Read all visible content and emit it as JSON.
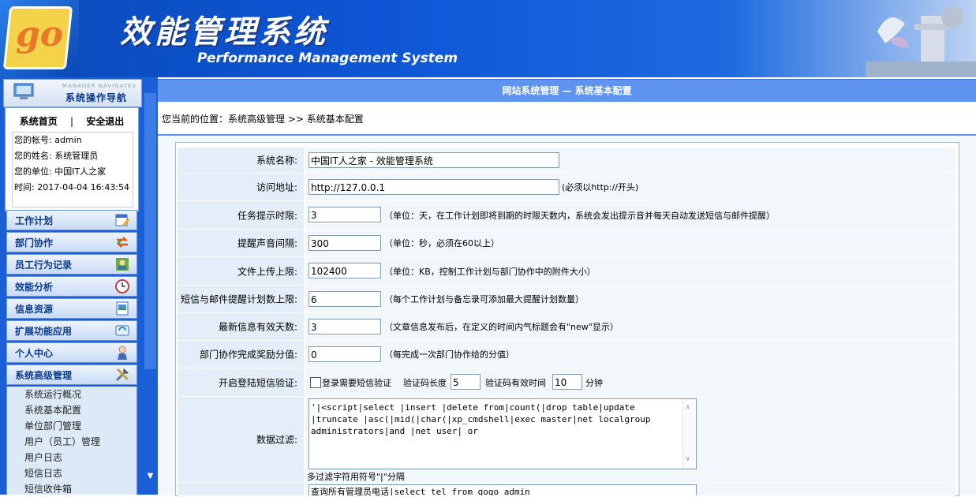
{
  "header": {
    "logo_text": "go",
    "title": "效能管理系统",
    "subtitle": "Performance Management System"
  },
  "sidebar": {
    "nav_small": "MANAGER NAVIGATES",
    "nav_title": "系统操作导航",
    "home_link": "系统首页",
    "link_sep": "|",
    "logout_link": "安全退出",
    "user_info": [
      "您的帐号:  admin",
      "您的姓名:  系统管理员",
      "您的单位:  中国IT人之家",
      "时间:  2017-04-04 16:43:54"
    ],
    "menus": [
      {
        "label": "工作计划",
        "icon": "calendar-edit-icon"
      },
      {
        "label": "部门协作",
        "icon": "exchange-arrows-icon"
      },
      {
        "label": "员工行为记录",
        "icon": "user-record-icon"
      },
      {
        "label": "效能分析",
        "icon": "clock-icon"
      },
      {
        "label": "信息资源",
        "icon": "document-image-icon"
      },
      {
        "label": "扩展功能应用",
        "icon": "extension-icon"
      },
      {
        "label": "个人中心",
        "icon": "person-icon"
      },
      {
        "label": "系统高级管理",
        "icon": "tools-icon"
      }
    ],
    "submenu": [
      "系统运行概况",
      "系统基本配置",
      "单位部门管理",
      "用户（员工）管理",
      "用户日志",
      "短信日志",
      "短信收件箱"
    ]
  },
  "main": {
    "title": "网站系统管理 — 系统基本配置",
    "breadcrumb": "您当前的位置：系统高级管理 >> 系统基本配置"
  },
  "form": {
    "site_name": {
      "label": "系统名称:",
      "value": "中国IT人之家 - 效能管理系统"
    },
    "site_url": {
      "label": "访问地址:",
      "value": "http://127.0.0.1",
      "note": "(必须以http://开头)"
    },
    "task_limit": {
      "label": "任务提示时限:",
      "value": "3",
      "note": "（单位：天，在工作计划即将到期的时限天数内，系统会发出提示音并每天自动发送短信与邮件提醒）"
    },
    "sound_interval": {
      "label": "提醒声音间隔:",
      "value": "300",
      "note": "（单位：秒，必须在60以上）"
    },
    "upload_limit": {
      "label": "文件上传上限:",
      "value": "102400",
      "note": "（单位：KB，控制工作计划与部门协作中的附件大小）"
    },
    "reminder_limit": {
      "label": "短信与邮件提醒计划数上限:",
      "value": "6",
      "note": "（每个工作计划与备忘录可添加最大提醒计划数量）"
    },
    "news_days": {
      "label": "最新信息有效天数:",
      "value": "3",
      "note": "（文章信息发布后，在定义的时间内气标题会有\"new\"显示）"
    },
    "collab_score": {
      "label": "部门协作完成奖励分值:",
      "value": "0",
      "note": "（每完成一次部门协作给的分值）"
    },
    "sms_login": {
      "label": "开启登陆短信验证:",
      "checkbox_label": "登录需要短信验证",
      "code_len_label": "验证码长度",
      "code_len": "5",
      "valid_label": "验证码有效时间",
      "valid_value": "10",
      "unit": "分钟"
    },
    "data_filter": {
      "label": "数据过滤:",
      "value": "'|<script|select |insert |delete from|count(|drop table|update |truncate |asc(|mid(|char(|xp_cmdshell|exec master|net localgroup administrators|and |net user| or ",
      "hint": "多过滤字符用符号\"|\"分隔"
    },
    "next_partial": {
      "value": "查询所有管理员电话|select tel from gogo_admin"
    }
  }
}
